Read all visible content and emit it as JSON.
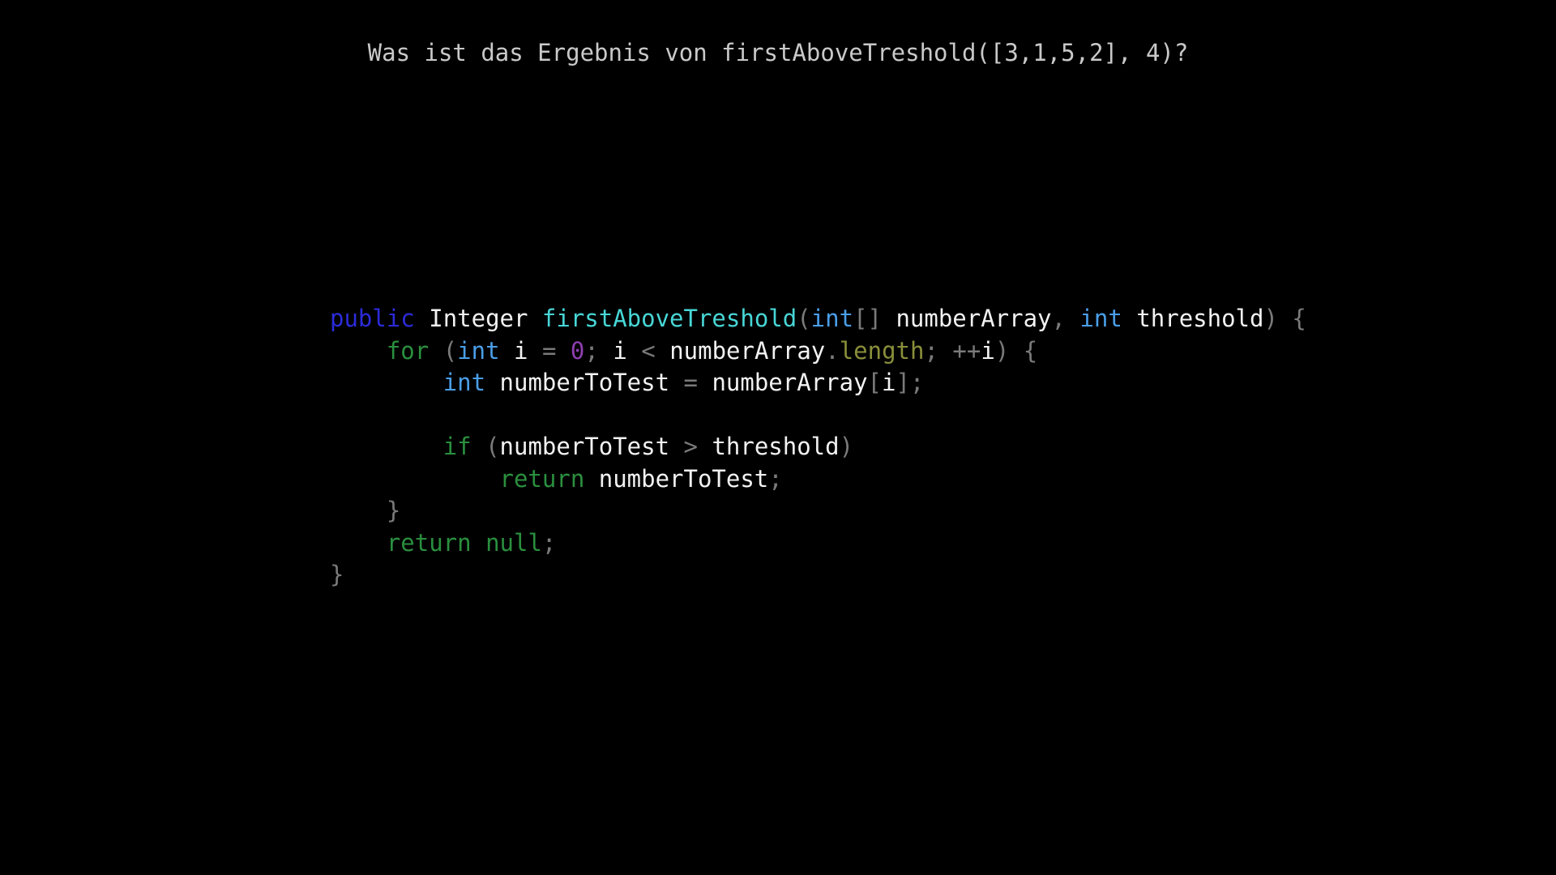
{
  "question": "Was ist das Ergebnis von firstAboveTreshold([3,1,5,2], 4)?",
  "colors": {
    "background": "#000000",
    "modifier": "#2b2bd9",
    "function_name": "#48d6d6",
    "primitive_type": "#4a9ee8",
    "keyword": "#2a8f3e",
    "number": "#8e3fb0",
    "field": "#8a8f3a",
    "punctuation": "#7a7a7a",
    "identifier": "#f2f2f2"
  },
  "code_lines": [
    [
      {
        "t": "public",
        "k": "modifier"
      },
      {
        "t": " ",
        "k": "space"
      },
      {
        "t": "Integer",
        "k": "type-class"
      },
      {
        "t": " ",
        "k": "space"
      },
      {
        "t": "firstAboveTreshold",
        "k": "fn"
      },
      {
        "t": "(",
        "k": "punct"
      },
      {
        "t": "int",
        "k": "prim"
      },
      {
        "t": "[]",
        "k": "punct"
      },
      {
        "t": " ",
        "k": "space"
      },
      {
        "t": "numberArray",
        "k": "ident"
      },
      {
        "t": ",",
        "k": "punct"
      },
      {
        "t": " ",
        "k": "space"
      },
      {
        "t": "int",
        "k": "prim"
      },
      {
        "t": " ",
        "k": "space"
      },
      {
        "t": "threshold",
        "k": "ident"
      },
      {
        "t": ")",
        "k": "punct"
      },
      {
        "t": " ",
        "k": "space"
      },
      {
        "t": "{",
        "k": "punct"
      }
    ],
    [
      {
        "t": "    ",
        "k": "space"
      },
      {
        "t": "for",
        "k": "keyword"
      },
      {
        "t": " ",
        "k": "space"
      },
      {
        "t": "(",
        "k": "punct"
      },
      {
        "t": "int",
        "k": "prim"
      },
      {
        "t": " ",
        "k": "space"
      },
      {
        "t": "i",
        "k": "ident"
      },
      {
        "t": " ",
        "k": "space"
      },
      {
        "t": "=",
        "k": "punct"
      },
      {
        "t": " ",
        "k": "space"
      },
      {
        "t": "0",
        "k": "number"
      },
      {
        "t": ";",
        "k": "punct"
      },
      {
        "t": " ",
        "k": "space"
      },
      {
        "t": "i",
        "k": "ident"
      },
      {
        "t": " ",
        "k": "space"
      },
      {
        "t": "<",
        "k": "punct"
      },
      {
        "t": " ",
        "k": "space"
      },
      {
        "t": "numberArray",
        "k": "ident"
      },
      {
        "t": ".",
        "k": "punct"
      },
      {
        "t": "length",
        "k": "field"
      },
      {
        "t": ";",
        "k": "punct"
      },
      {
        "t": " ",
        "k": "space"
      },
      {
        "t": "++",
        "k": "punct"
      },
      {
        "t": "i",
        "k": "ident"
      },
      {
        "t": ")",
        "k": "punct"
      },
      {
        "t": " ",
        "k": "space"
      },
      {
        "t": "{",
        "k": "punct"
      }
    ],
    [
      {
        "t": "        ",
        "k": "space"
      },
      {
        "t": "int",
        "k": "prim"
      },
      {
        "t": " ",
        "k": "space"
      },
      {
        "t": "numberToTest",
        "k": "ident"
      },
      {
        "t": " ",
        "k": "space"
      },
      {
        "t": "=",
        "k": "punct"
      },
      {
        "t": " ",
        "k": "space"
      },
      {
        "t": "numberArray",
        "k": "ident"
      },
      {
        "t": "[",
        "k": "punct"
      },
      {
        "t": "i",
        "k": "ident"
      },
      {
        "t": "];",
        "k": "punct"
      }
    ],
    [],
    [
      {
        "t": "        ",
        "k": "space"
      },
      {
        "t": "if",
        "k": "keyword"
      },
      {
        "t": " ",
        "k": "space"
      },
      {
        "t": "(",
        "k": "punct"
      },
      {
        "t": "numberToTest",
        "k": "ident"
      },
      {
        "t": " ",
        "k": "space"
      },
      {
        "t": ">",
        "k": "punct"
      },
      {
        "t": " ",
        "k": "space"
      },
      {
        "t": "threshold",
        "k": "ident"
      },
      {
        "t": ")",
        "k": "punct"
      }
    ],
    [
      {
        "t": "            ",
        "k": "space"
      },
      {
        "t": "return",
        "k": "keyword"
      },
      {
        "t": " ",
        "k": "space"
      },
      {
        "t": "numberToTest",
        "k": "ident"
      },
      {
        "t": ";",
        "k": "punct"
      }
    ],
    [
      {
        "t": "    ",
        "k": "space"
      },
      {
        "t": "}",
        "k": "punct"
      }
    ],
    [
      {
        "t": "    ",
        "k": "space"
      },
      {
        "t": "return",
        "k": "keyword"
      },
      {
        "t": " ",
        "k": "space"
      },
      {
        "t": "null",
        "k": "literal"
      },
      {
        "t": ";",
        "k": "punct"
      }
    ],
    [
      {
        "t": "}",
        "k": "punct"
      }
    ]
  ]
}
